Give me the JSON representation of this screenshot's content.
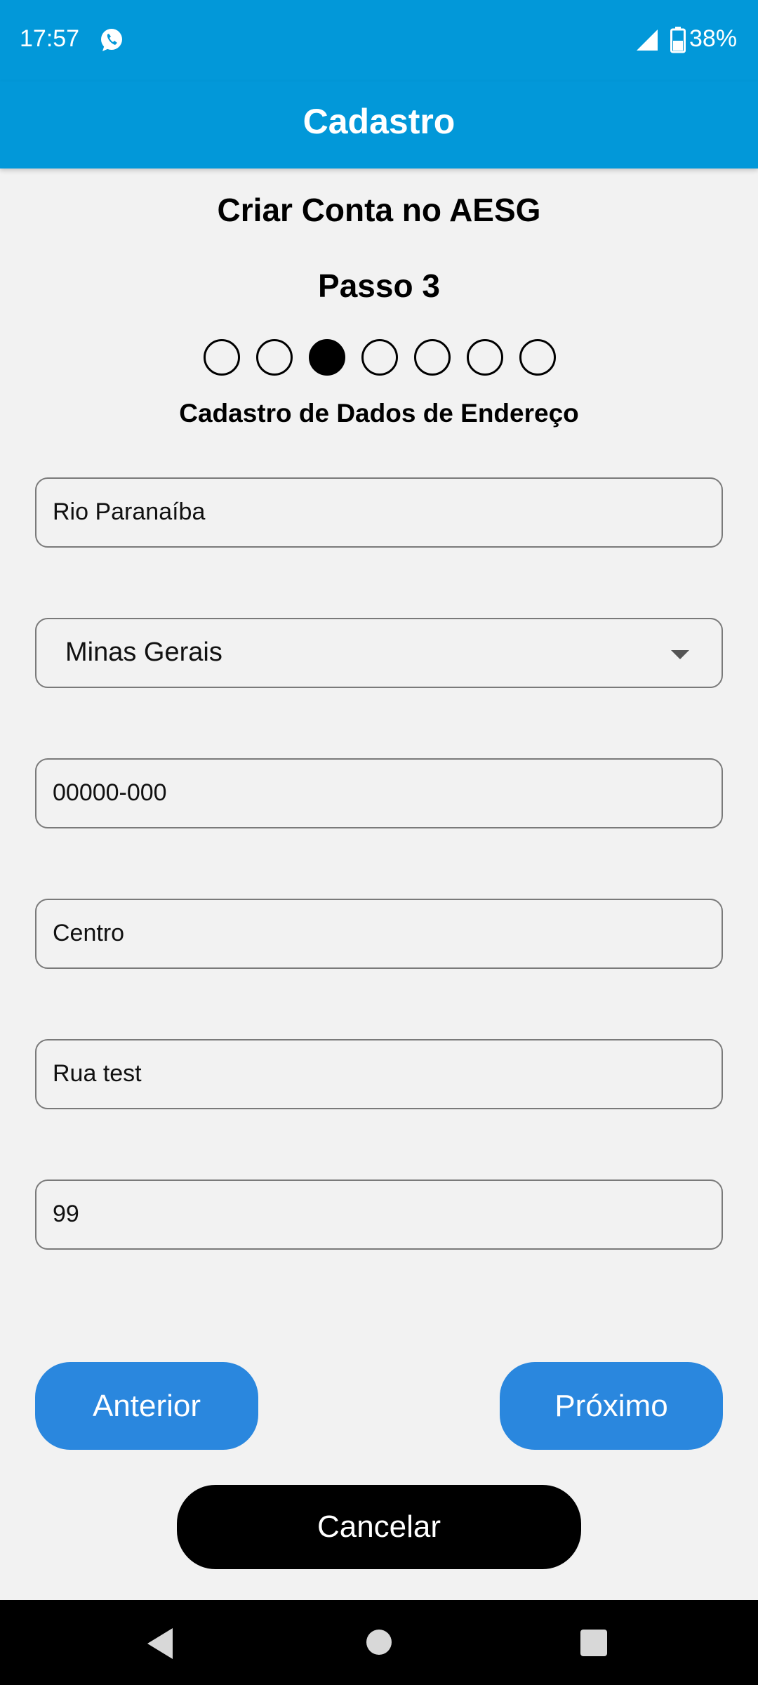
{
  "status_bar": {
    "time": "17:57",
    "battery": "38%",
    "icons": [
      "whatsapp-icon",
      "signal-icon",
      "battery-icon"
    ]
  },
  "app_bar": {
    "title": "Cadastro"
  },
  "form": {
    "title": "Criar Conta no AESG",
    "step_label": "Passo 3",
    "step_indicator": {
      "total": 7,
      "current": 3
    },
    "section_title": "Cadastro de Dados de Endereço",
    "fields": {
      "city": "Rio Paranaíba",
      "state": "Minas Gerais",
      "cep": "00000-000",
      "neighborhood": "Centro",
      "street": "Rua test",
      "number": "99"
    }
  },
  "buttons": {
    "previous": "Anterior",
    "next": "Próximo",
    "cancel": "Cancelar"
  },
  "colors": {
    "app_bar": "#0298d9",
    "primary_button": "#2a87de",
    "cancel_button": "#000000",
    "background": "#f2f2f2"
  },
  "nav_bar": {
    "icons": [
      "back-icon",
      "home-icon",
      "recent-apps-icon"
    ]
  }
}
